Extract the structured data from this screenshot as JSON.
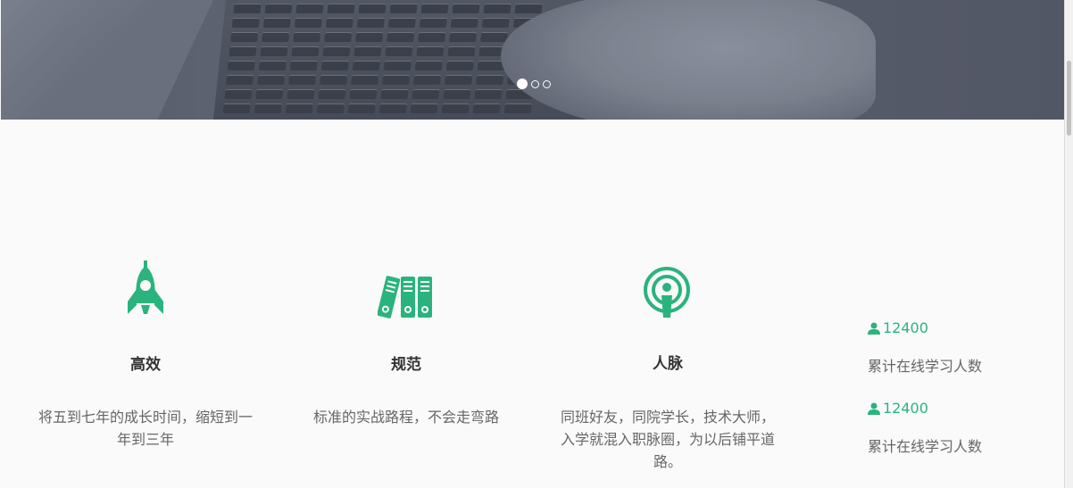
{
  "carousel": {
    "slides": 3,
    "active_index": 0
  },
  "features": [
    {
      "icon": "rocket-icon",
      "title": "高效",
      "desc_lines": [
        "将五到七年的成长时间，缩短到一",
        "年到三年"
      ]
    },
    {
      "icon": "binders-icon",
      "title": "规范",
      "desc_lines": [
        "标准的实战路程，不会走弯路"
      ]
    },
    {
      "icon": "podcast-icon",
      "title": "人脉",
      "desc_lines": [
        "同班好友，同院学长，技术大师，",
        "入学就混入职脉圈，为以后铺平道",
        "路。"
      ]
    }
  ],
  "stats": [
    {
      "icon": "user-icon",
      "value": "12400",
      "label": "累计在线学习人数"
    },
    {
      "icon": "user-icon",
      "value": "12400",
      "label": "累计在线学习人数"
    }
  ],
  "colors": {
    "accent": "#2bb37e",
    "text": "#666666",
    "heading": "#333333",
    "background": "#fafafa"
  }
}
